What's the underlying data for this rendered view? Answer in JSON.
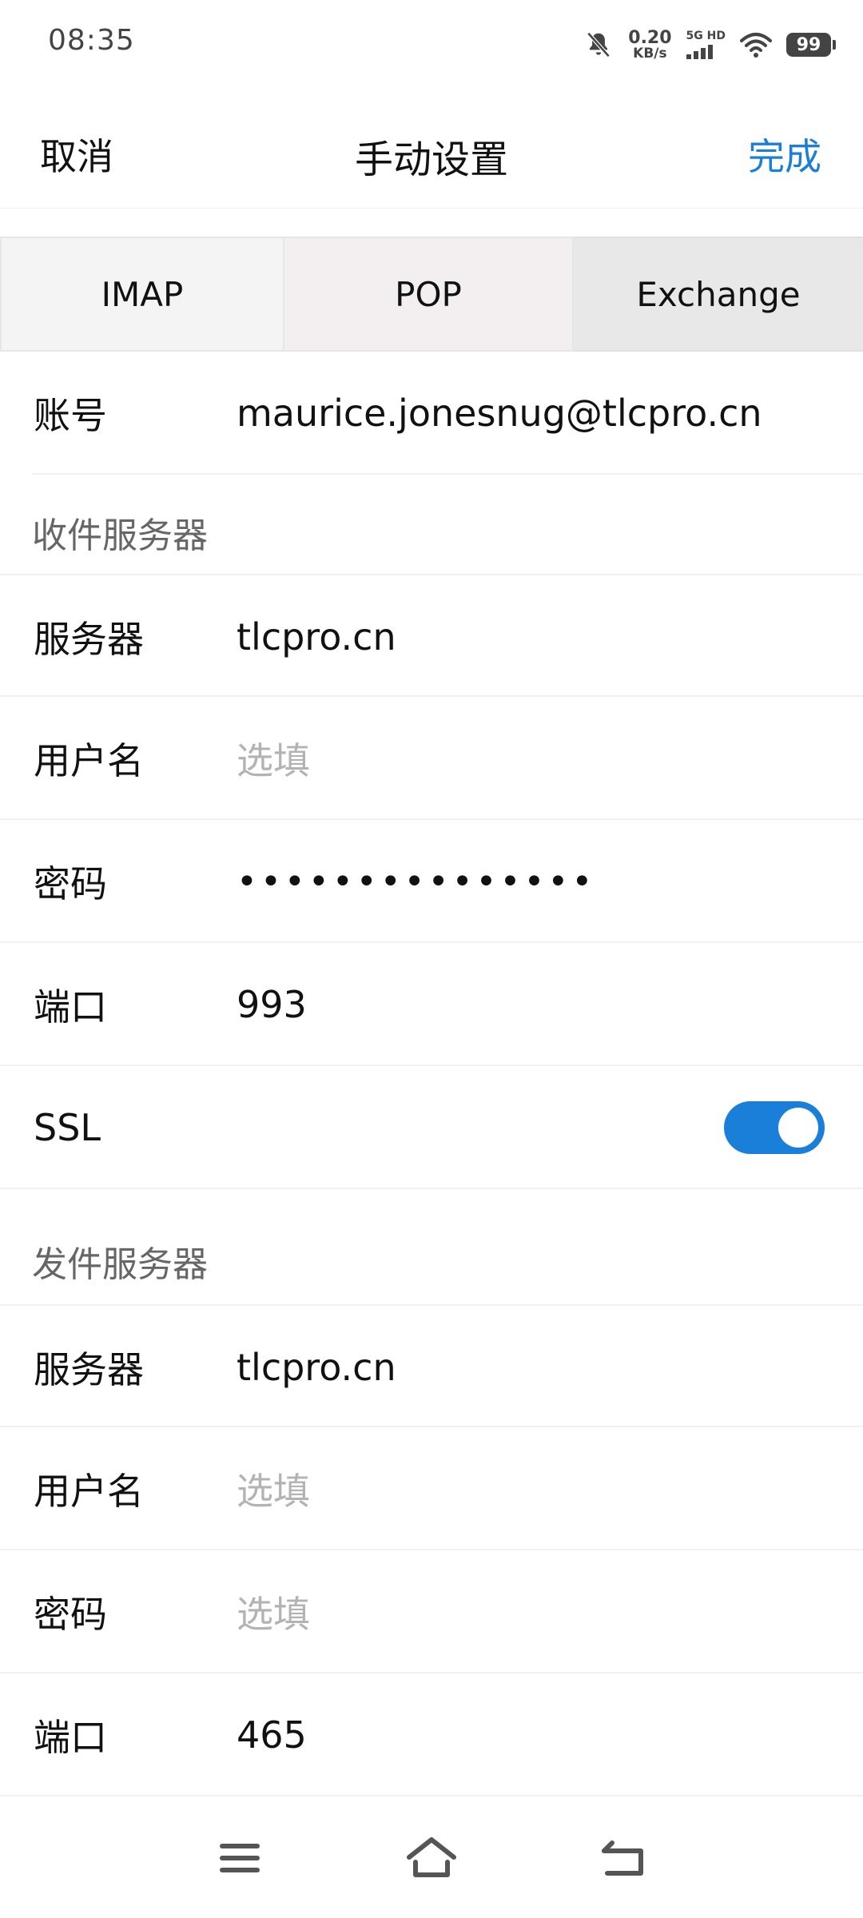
{
  "status_bar": {
    "time": "08:35",
    "net_speed_value": "0.20",
    "net_speed_unit": "KB/s",
    "network_label": "5G HD",
    "battery_level": "99",
    "icons": [
      "mute-icon",
      "signal-icon",
      "wifi-icon",
      "battery-icon"
    ]
  },
  "header": {
    "cancel_label": "取消",
    "title": "手动设置",
    "done_label": "完成"
  },
  "tabs": [
    {
      "label": "IMAP"
    },
    {
      "label": "POP"
    },
    {
      "label": "Exchange"
    }
  ],
  "account": {
    "label": "账号",
    "value": "maurice.jonesnug@tlcpro.cn"
  },
  "incoming": {
    "section_title": "收件服务器",
    "server_label": "服务器",
    "server_value": "tlcpro.cn",
    "username_label": "用户名",
    "username_placeholder": "选填",
    "password_label": "密码",
    "password_value": "•••••••••••••••",
    "port_label": "端口",
    "port_value": "993",
    "ssl_label": "SSL",
    "ssl_enabled": true
  },
  "outgoing": {
    "section_title": "发件服务器",
    "server_label": "服务器",
    "server_value": "tlcpro.cn",
    "username_label": "用户名",
    "username_placeholder": "选填",
    "password_label": "密码",
    "password_placeholder": "选填",
    "port_label": "端口",
    "port_value": "465"
  },
  "colors": {
    "accent": "#1a7fd9",
    "placeholder": "#b3b3b3",
    "section_title": "#666666"
  },
  "navbar": {
    "icons": [
      "menu-icon",
      "home-icon",
      "back-icon"
    ]
  }
}
